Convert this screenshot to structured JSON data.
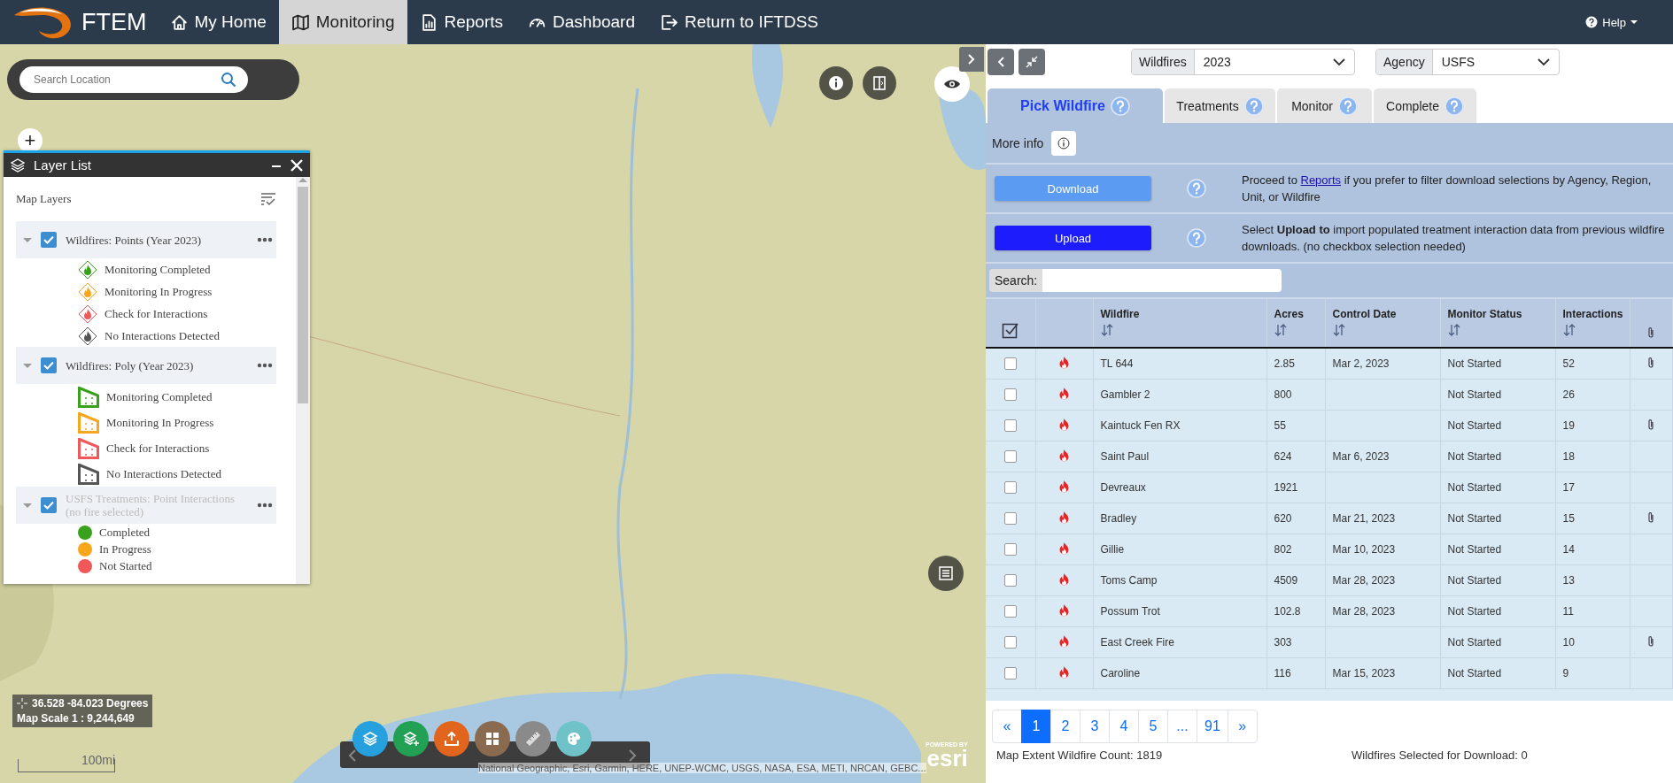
{
  "nav": {
    "logo": "FTEM",
    "items": [
      {
        "label": "My Home",
        "selected": false
      },
      {
        "label": "Monitoring",
        "selected": true
      },
      {
        "label": "Reports",
        "selected": false
      },
      {
        "label": "Dashboard",
        "selected": false
      },
      {
        "label": "Return to IFTDSS",
        "selected": false
      }
    ],
    "help": "Help"
  },
  "map": {
    "search": {
      "placeholder": "Search Location"
    },
    "zoom_in": "+",
    "coordinates": "36.528 -84.023 Degrees",
    "scale": "Map Scale 1 : 9,244,649",
    "scalebar": "100mi",
    "attribution": "National Geographic, Esri, Garmin, HERE, UNEP-WCMC, USGS, NASA, ESA, METI, NRCAN, GEBC...",
    "powered_by": "POWERED BY",
    "esri": "esri"
  },
  "layer_list": {
    "title": "Layer List",
    "heading": "Map Layers",
    "layers": [
      {
        "title": "Wildfires: Points (Year 2023)",
        "kind": "point",
        "checked": true,
        "disabled": false,
        "legend": [
          {
            "label": "Monitoring Completed",
            "color": "#3aa11c"
          },
          {
            "label": "Monitoring In Progress",
            "color": "#f8a61c"
          },
          {
            "label": "Check for Interactions",
            "color": "#f0585a"
          },
          {
            "label": "No Interactions Detected",
            "color": "#555555"
          }
        ]
      },
      {
        "title": "Wildfires: Poly (Year 2023)",
        "kind": "poly",
        "checked": true,
        "disabled": false,
        "legend": [
          {
            "label": "Monitoring Completed",
            "color": "#3aa11c"
          },
          {
            "label": "Monitoring In Progress",
            "color": "#f8a61c"
          },
          {
            "label": "Check for Interactions",
            "color": "#f0585a"
          },
          {
            "label": "No Interactions Detected",
            "color": "#555555"
          }
        ]
      },
      {
        "title": "USFS Treatments: Point Interactions (no fire selected)",
        "kind": "dot",
        "checked": true,
        "disabled": true,
        "legend": [
          {
            "label": "Completed",
            "color": "#3aa11c"
          },
          {
            "label": "In Progress",
            "color": "#f8a61c"
          },
          {
            "label": "Not Started",
            "color": "#f0585a"
          }
        ]
      }
    ]
  },
  "panel": {
    "filters": [
      {
        "label": "Wildfires",
        "value": "2023"
      },
      {
        "label": "Agency",
        "value": "USFS"
      }
    ],
    "tabs": [
      {
        "label": "Pick Wildfire",
        "selected": true
      },
      {
        "label": "Treatments",
        "selected": false
      },
      {
        "label": "Monitor",
        "selected": false
      },
      {
        "label": "Complete",
        "selected": false
      }
    ],
    "more_info": "More info",
    "actions": [
      {
        "kind": "download",
        "button": "Download",
        "text_before": "Proceed to ",
        "link": "Reports",
        "text_after": " if you prefer to filter download selections by Agency, Region, Unit, or Wildfire"
      },
      {
        "kind": "upload",
        "button": "Upload",
        "text": "Select **Upload to** import populated treatment interaction data from previous wildfire downloads. (no checkbox selection needed)"
      }
    ],
    "search": {
      "label": "Search:"
    },
    "table": {
      "columns": [
        "Wildfire",
        "Acres",
        "Control Date",
        "Monitor Status",
        "Interactions"
      ],
      "rows": [
        {
          "checked": false,
          "wildfire": "TL 644",
          "acres": "2.85",
          "control_date": "Mar 2, 2023",
          "monitor_status": "Not Started",
          "interactions": "52",
          "attachment": true
        },
        {
          "checked": false,
          "wildfire": "Gambler 2",
          "acres": "800",
          "monitor_status": "Not Started",
          "interactions": "26",
          "attachment": false
        },
        {
          "checked": false,
          "wildfire": "Kaintuck Fen RX",
          "acres": "55",
          "monitor_status": "Not Started",
          "interactions": "19",
          "attachment": true
        },
        {
          "checked": false,
          "wildfire": "Saint Paul",
          "acres": "624",
          "control_date": "Mar 6, 2023",
          "monitor_status": "Not Started",
          "interactions": "18",
          "attachment": false
        },
        {
          "checked": false,
          "wildfire": "Devreaux",
          "acres": "1921",
          "monitor_status": "Not Started",
          "interactions": "17",
          "attachment": false
        },
        {
          "checked": false,
          "wildfire": "Bradley",
          "acres": "620",
          "control_date": "Mar 21, 2023",
          "monitor_status": "Not Started",
          "interactions": "15",
          "attachment": true
        },
        {
          "checked": false,
          "wildfire": "Gillie",
          "acres": "802",
          "control_date": "Mar 10, 2023",
          "monitor_status": "Not Started",
          "interactions": "14",
          "attachment": false
        },
        {
          "checked": false,
          "wildfire": "Toms Camp",
          "acres": "4509",
          "control_date": "Mar 28, 2023",
          "monitor_status": "Not Started",
          "interactions": "13",
          "attachment": false
        },
        {
          "checked": false,
          "wildfire": "Possum Trot",
          "acres": "102.8",
          "control_date": "Mar 28, 2023",
          "monitor_status": "Not Started",
          "interactions": "11",
          "attachment": false
        },
        {
          "checked": false,
          "wildfire": "East Creek Fire",
          "acres": "303",
          "monitor_status": "Not Started",
          "interactions": "10",
          "attachment": true
        },
        {
          "checked": false,
          "wildfire": "Caroline",
          "acres": "116",
          "control_date": "Mar 15, 2023",
          "monitor_status": "Not Started",
          "interactions": "9",
          "attachment": false
        }
      ]
    },
    "pagination": [
      {
        "label": "«",
        "selected": false
      },
      {
        "label": "1",
        "selected": true
      },
      {
        "label": "2",
        "selected": false
      },
      {
        "label": "3",
        "selected": false
      },
      {
        "label": "4",
        "selected": false
      },
      {
        "label": "5",
        "selected": false
      },
      {
        "label": "...",
        "selected": false
      },
      {
        "label": "91",
        "selected": false
      },
      {
        "label": "»",
        "selected": false
      }
    ],
    "footer": {
      "count": "Map Extent Wildfire Count: 1819",
      "selected_count": "Wildfires Selected for Download: 0"
    }
  }
}
